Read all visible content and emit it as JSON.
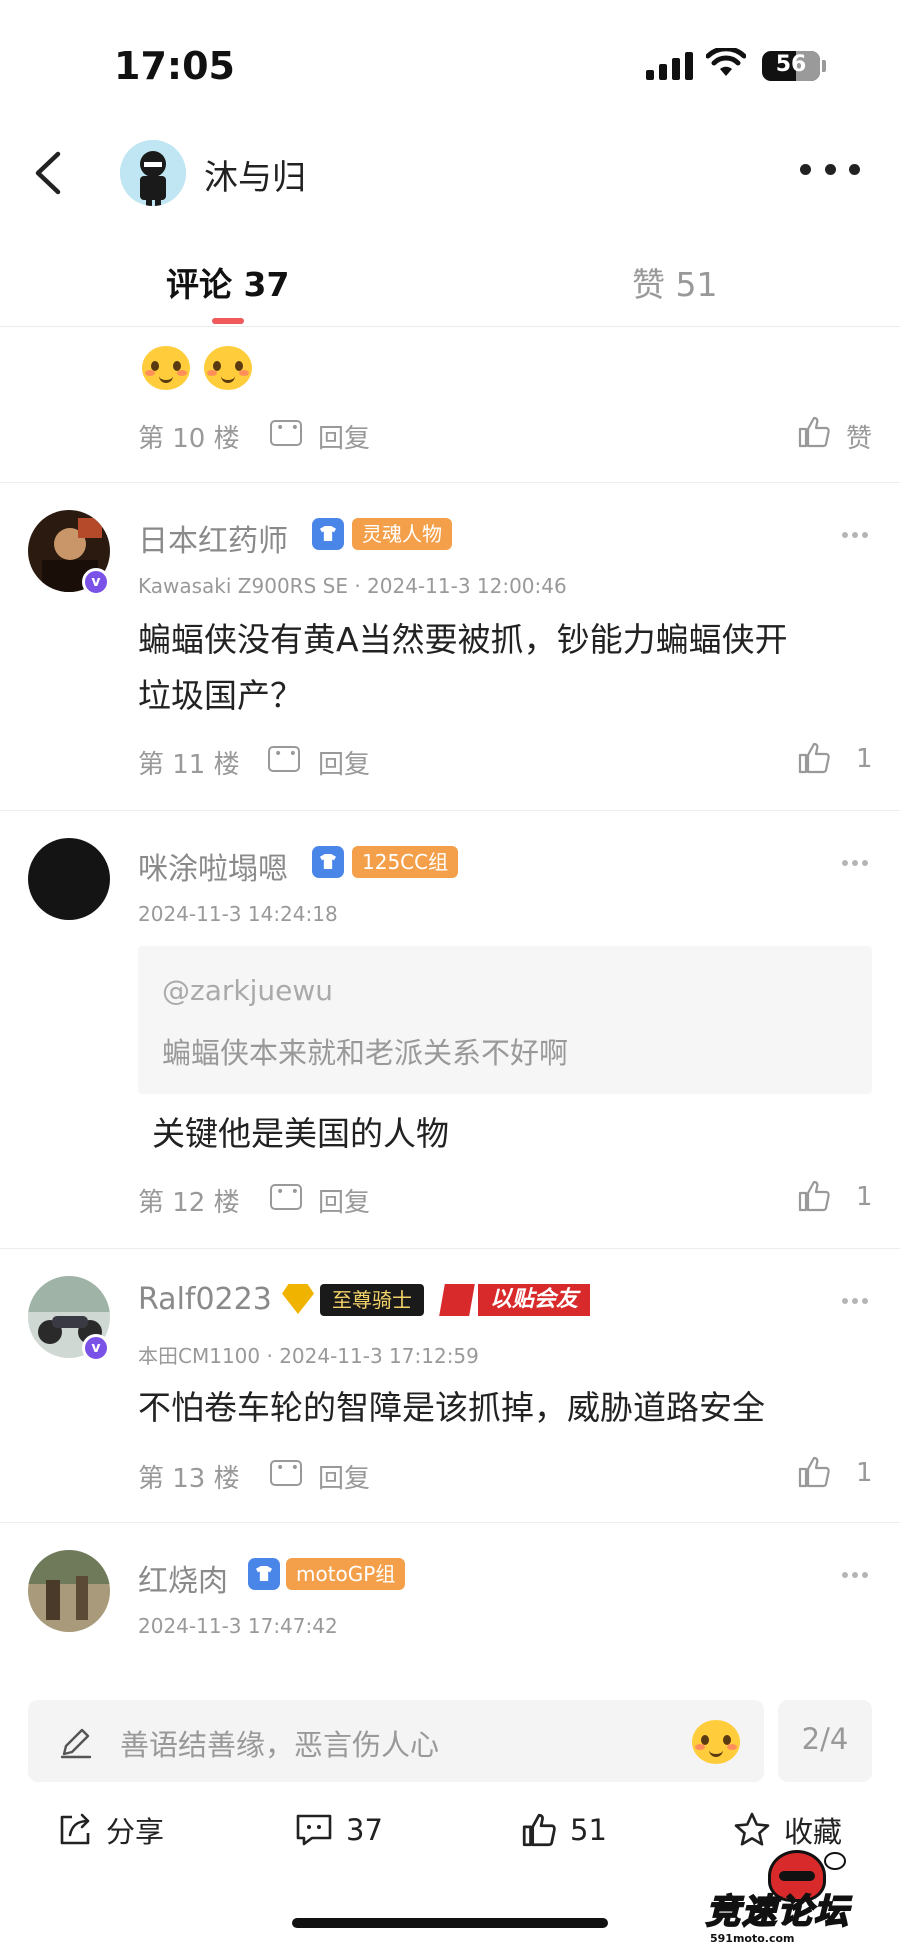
{
  "status": {
    "time": "17:05",
    "battery": "56"
  },
  "header": {
    "username": "沐与归"
  },
  "tabs": {
    "comments_label": "评论",
    "comments_count": "37",
    "likes_label": "赞",
    "likes_count": "51"
  },
  "comments": [
    {
      "floor": "第 10 楼",
      "reply": "回复",
      "like": "赞"
    },
    {
      "name": "日本红药师",
      "badge": "灵魂人物",
      "meta": "Kawasaki Z900RS SE · 2024-11-3 12:00:46",
      "text_line1": "蝙蝠侠没有黄A当然要被抓，钞能力蝙蝠侠开",
      "text_line2": "垃圾国产？",
      "floor": "第 11 楼",
      "reply": "回复",
      "likes": "1"
    },
    {
      "name": "咪涂啦塌嗯",
      "badge": "125CC组",
      "meta": "2024-11-3 14:24:18",
      "quote_user": "@zarkjuewu",
      "quote_text": "蝙蝠侠本来就和老派关系不好啊",
      "text": "关键他是美国的人物",
      "floor": "第 12 楼",
      "reply": "回复",
      "likes": "1"
    },
    {
      "name": "Ralf0223",
      "badge_knight": "至尊骑士",
      "badge_club": "以贴会友",
      "meta": "本田CM1100 · 2024-11-3 17:12:59",
      "text": "不怕卷车轮的智障是该抓掉，威胁道路安全",
      "floor": "第 13 楼",
      "reply": "回复",
      "likes": "1"
    },
    {
      "name": "红烧肉",
      "badge": "motoGP组",
      "meta": "2024-11-3 17:47:42"
    }
  ],
  "bottom": {
    "placeholder": "善语结善缘，恶言伤人心",
    "page": "2/4",
    "share": "分享",
    "comments": "37",
    "likes": "51",
    "favorite": "收藏"
  },
  "watermark": {
    "text": "竞速论坛",
    "url": "591moto.com"
  },
  "colors": {
    "accent": "#f05a5a",
    "badge_orange": "#f4a04a",
    "verified_purple": "#7b52e8",
    "club_red": "#d82a2a"
  }
}
